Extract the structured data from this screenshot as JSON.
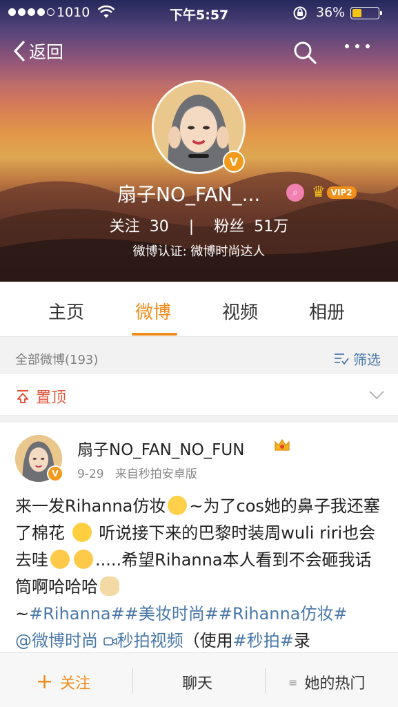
{
  "status_bar": {
    "carrier": "1010",
    "time": "下午5:57",
    "battery_percent_text": "36%",
    "battery_level": 0.36,
    "signal_strength": 4
  },
  "nav": {
    "back_label": "返回"
  },
  "profile": {
    "display_name": "扇子NO_FAN_...",
    "vip_label": "VIP2",
    "following_label": "关注",
    "following_count": "30",
    "stats_separator": "|",
    "followers_label": "粉丝",
    "followers_count": "51万",
    "verification": "微博认证: 微博时尚达人",
    "avatar_badge": "V"
  },
  "tabs": [
    {
      "label": "主页",
      "active": false
    },
    {
      "label": "微博",
      "active": true
    },
    {
      "label": "视频",
      "active": false
    },
    {
      "label": "相册",
      "active": false
    }
  ],
  "filter": {
    "count_label": "全部微博(193)",
    "filter_label": "筛选"
  },
  "pinned": {
    "label": "置顶"
  },
  "post": {
    "author": "扇子NO_FAN_NO_FUN",
    "date": "9-29",
    "source": "来自秒拍安卓版",
    "text_1": "来一发Rihanna仿妆",
    "text_2": "~为了cos她的鼻子我还塞了棉花",
    "text_3": "听说接下来的巴黎时装周wuli riri也会去哇",
    "text_4": ".....希望Rihanna本人看到不会砸我话筒啊哈哈哈",
    "text_5": "~",
    "tag_1": "#Rihanna#",
    "tag_2": "#美妆时尚#",
    "tag_3": "#Rihanna仿妆#",
    "mention": "@微博时尚",
    "video_link": "秒拍视频",
    "text_6": "（使用",
    "tag_4": "#秒拍#",
    "text_7": "录"
  },
  "bottom_bar": {
    "follow_plus": "+",
    "follow_label": "关注",
    "chat_label": "聊天",
    "hot_icon": "≡",
    "hot_label": "她的热门"
  },
  "colors": {
    "accent": "#f08c1b",
    "link": "#4a78a8",
    "pinned": "#e2553b",
    "vip": "#f08f1a"
  }
}
